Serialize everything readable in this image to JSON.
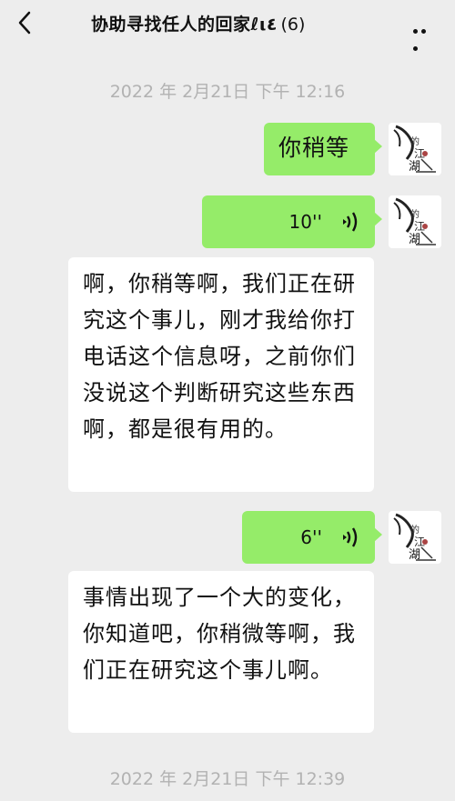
{
  "header": {
    "title": "协助寻找任人的回家ℓι٤",
    "count": "(6)"
  },
  "messages": {
    "time1": "2022 年 2月21日 下午 12:16",
    "m1": "你稍等",
    "voice1": "10''",
    "m2": "啊，你稍等啊，我们正在研究这个事儿，刚才我给你打电话这个信息呀，之前你们没说这个判断研究这些东西啊，都是很有用的。",
    "voice2": "6''",
    "m3": "事情出现了一个大的变化，你知道吧，你稍微等啊，我们正在研究这个事儿啊。",
    "time2": "2022 年 2月21日 下午 12:39"
  },
  "icons": {
    "back": "chevron-left-icon",
    "more": "more-dots-icon",
    "voice": "voice-wave-icon",
    "avatar": "ink-painting-avatar"
  },
  "colors": {
    "background": "#ededed",
    "my_bubble": "#95ec69",
    "other_bubble": "#ffffff",
    "timestamp": "#b2b2b2"
  }
}
